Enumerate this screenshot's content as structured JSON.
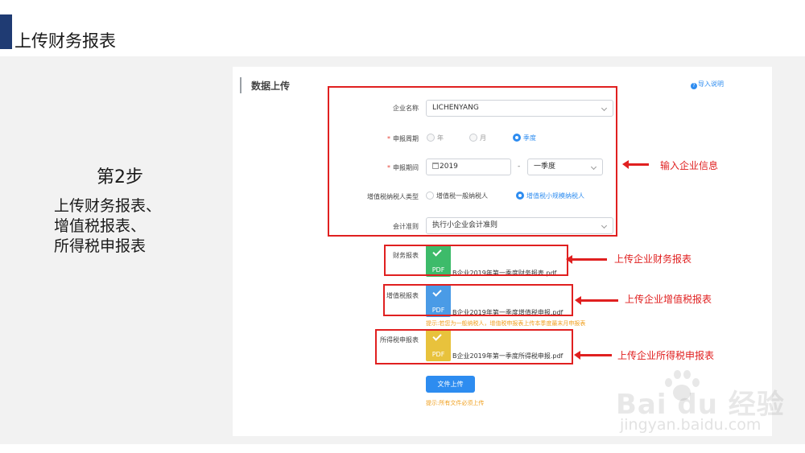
{
  "slide": {
    "title": "上传财务报表"
  },
  "step": {
    "heading": "第2步",
    "lines": [
      "上传财务报表、",
      "增值税报表、",
      "所得税申报表"
    ]
  },
  "panel": {
    "title": "数据上传",
    "import_help": "导入说明",
    "form": {
      "company_label": "企业名称",
      "company_value": "LICHENYANG",
      "period_type_label": "申报周期",
      "period_type_options": [
        "年",
        "月",
        "季度"
      ],
      "period_type_selected": "季度",
      "period_label": "申报期间",
      "period_year": "2019",
      "period_dash": "-",
      "period_quarter": "一季度",
      "taxpayer_label": "增值税纳税人类型",
      "taxpayer_options": [
        "增值税一般纳税人",
        "增值税小规模纳税人"
      ],
      "taxpayer_selected": "增值税小规模纳税人",
      "accounting_label": "会计准则",
      "accounting_value": "执行小企业会计准则"
    },
    "uploads": [
      {
        "label": "财务报表",
        "file_name": "B企业2019年第一季度财务报表.pdf",
        "icon_text": "PDF",
        "color": "#3dbb6a"
      },
      {
        "label": "增值税报表",
        "file_name": "B企业2019年第一季度增值税申报.pdf",
        "icon_text": "PDF",
        "color": "#4a9be6"
      },
      {
        "label": "所得税申报表",
        "file_name": "B企业2019年第一季度所得税申报.pdf",
        "icon_text": "PDF",
        "color": "#e8c23c"
      }
    ],
    "vat_hint": "提示:若您为一般纳税人，增值税申报表上传本季度最末月申报表",
    "upload_button": "文件上传",
    "upload_hint": "提示:所有文件必须上传"
  },
  "annotations": {
    "company_info": "输入企业信息",
    "financial": "上传企业财务报表",
    "vat": "上传企业增值税报表",
    "income_tax": "上传企业所得税申报表"
  },
  "watermark": {
    "brand": "Bai du 经验",
    "url": "jingyan.baidu.com"
  },
  "colors": {
    "accent": "#2d8cf0",
    "annotation_red": "#e02020",
    "title_bar": "#1f3b73",
    "hint": "#f0a020"
  }
}
